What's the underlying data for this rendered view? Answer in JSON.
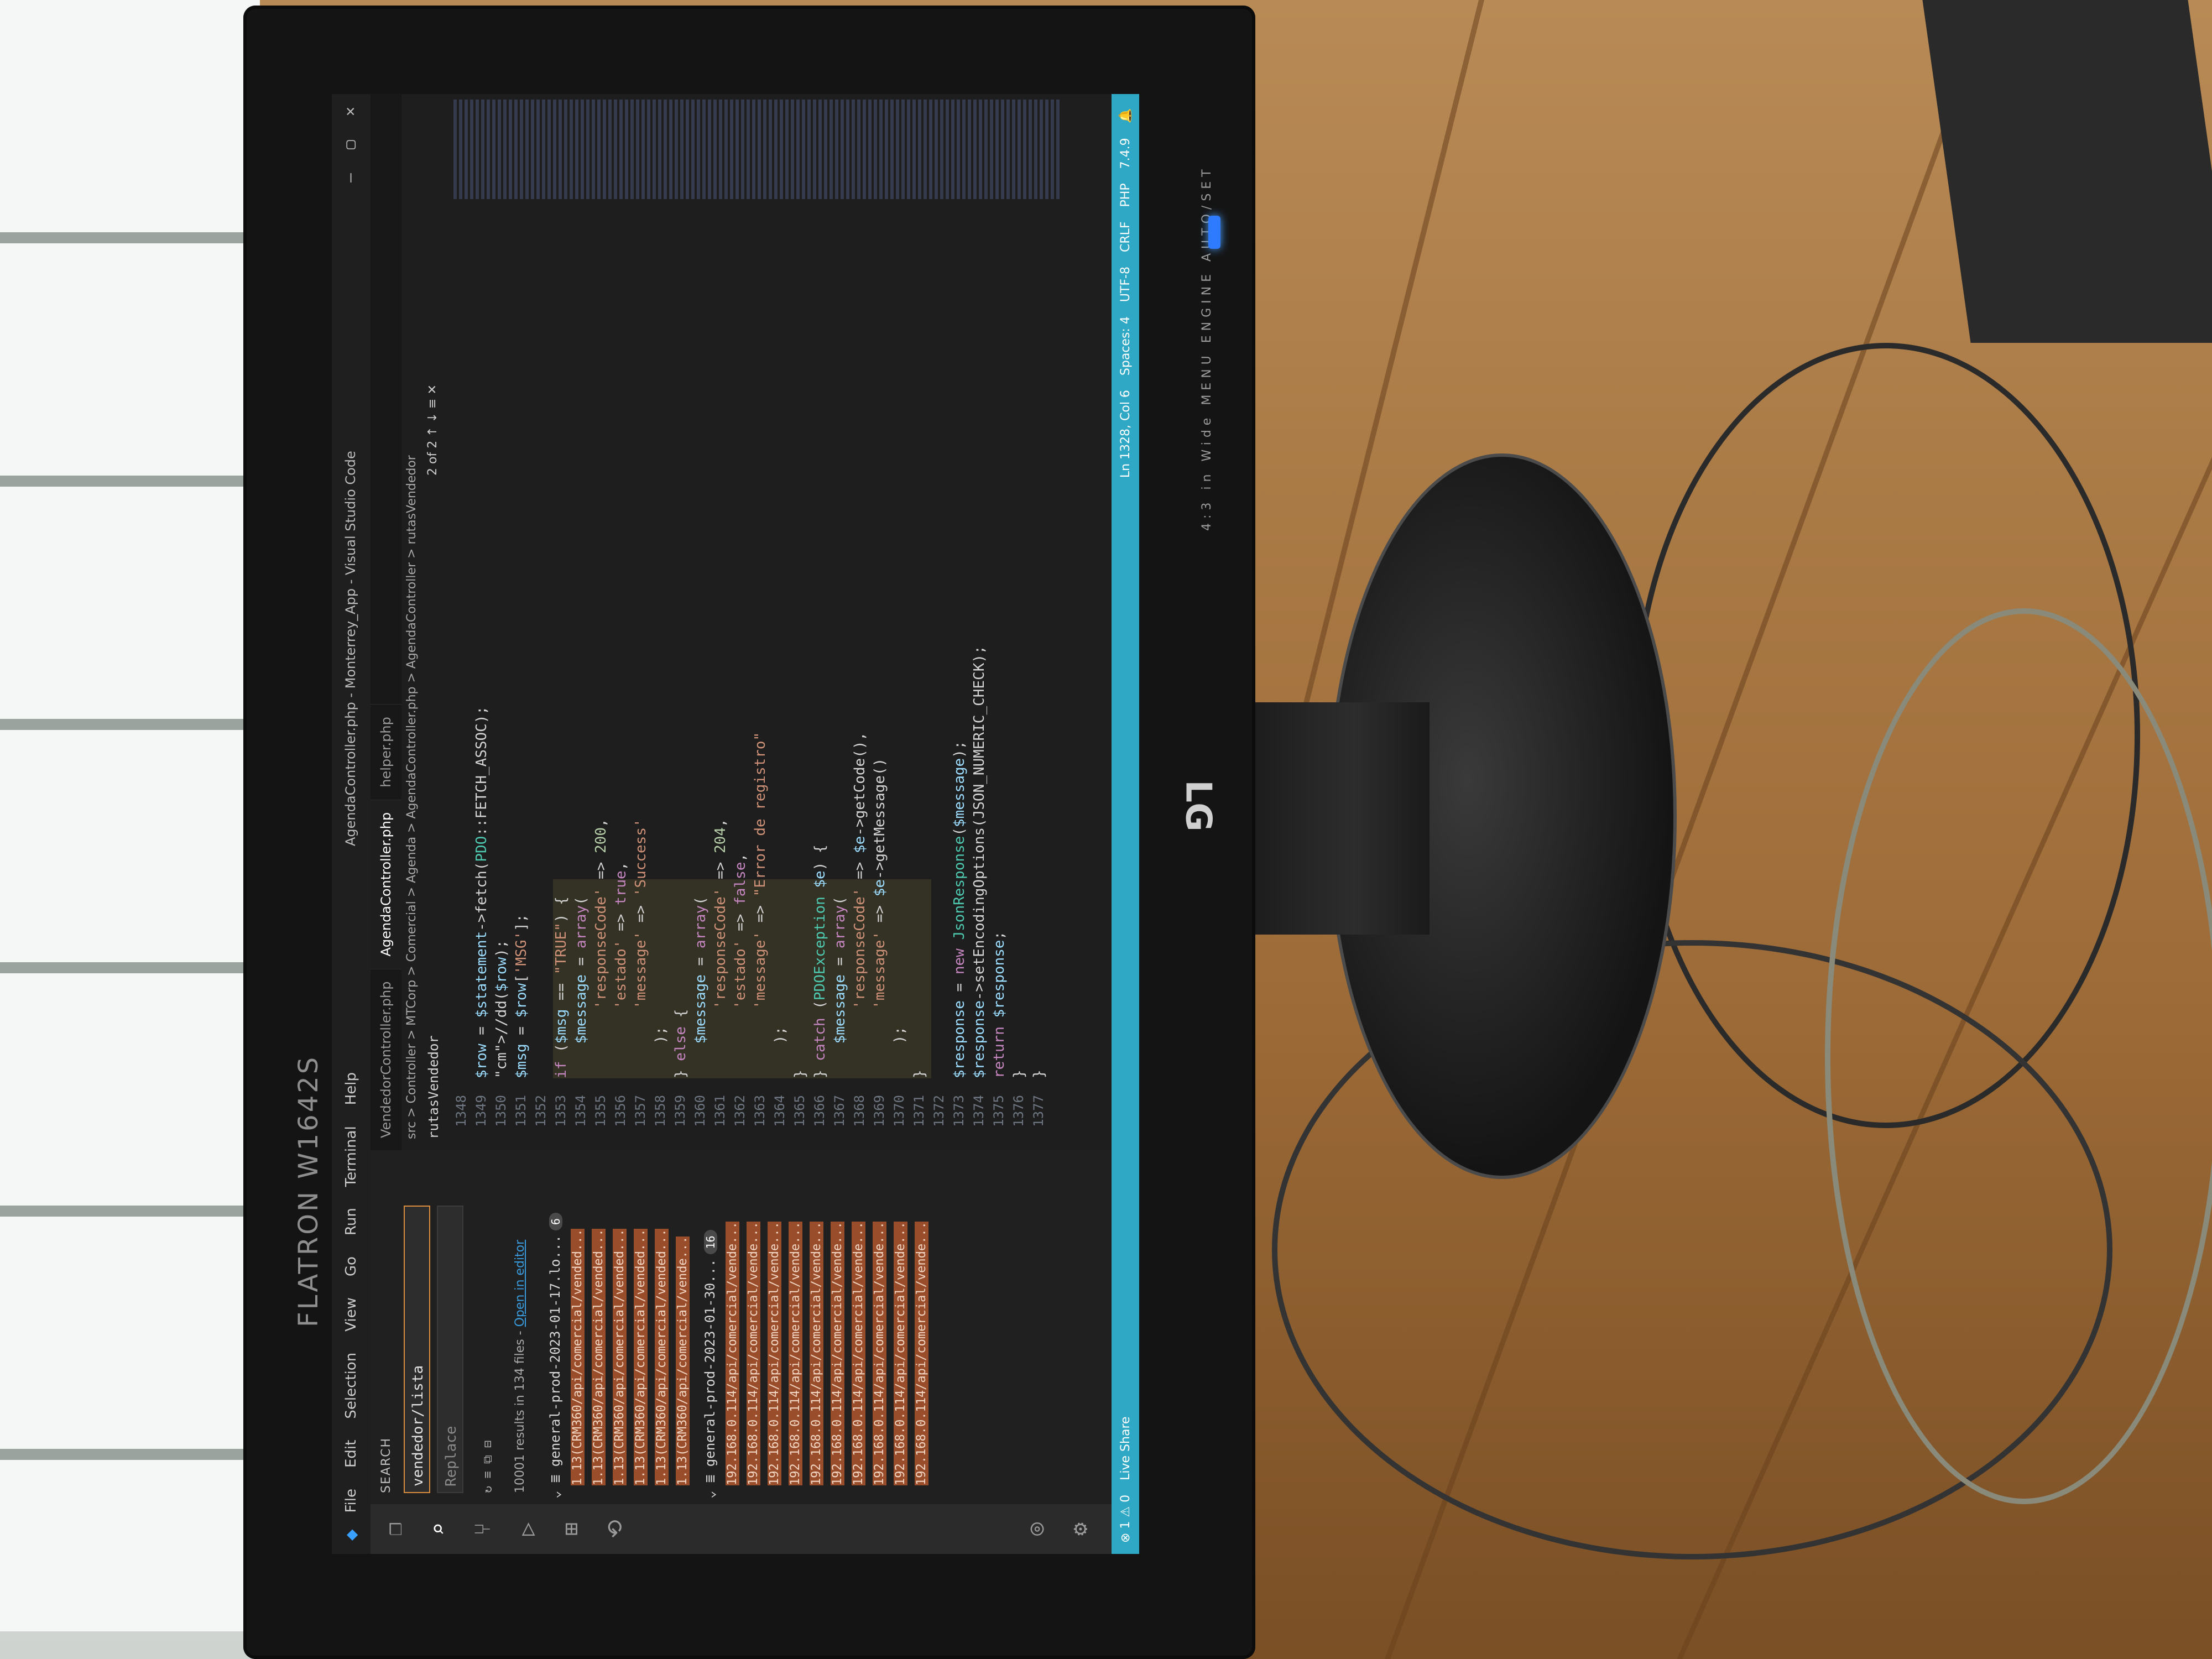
{
  "monitor": {
    "brand": "FLATRON W1642S",
    "logo": "LG",
    "controls": "4:3 in Wide   MENU   ENGINE   AUTO/SET"
  },
  "vscode": {
    "menu": [
      "File",
      "Edit",
      "Selection",
      "View",
      "Go",
      "Run",
      "Terminal",
      "Help"
    ],
    "window_title": "AgendaController.php - Monterrey_App - Visual Studio Code",
    "tabs": [
      "VendedorController.php",
      "AgendaController.php",
      "helper.php"
    ],
    "active_tab": "AgendaController.php",
    "breadcrumbs": "src > Controller > MTCorp > Comercial > Agenda > AgendaController.php > AgendaController > rutasVendedor",
    "sticky_scroll": "rutasVendedor",
    "find_widget": "2 of 2",
    "search": {
      "title": "SEARCH",
      "query": "vendedor/lista",
      "replace_placeholder": "Replace",
      "results_summary": "10001 results in 134 files - ",
      "open_in_editor": "Open in editor",
      "groups": [
        {
          "name": "general-prod-2023-01-17.lo...",
          "count": "6"
        },
        {
          "name": "general-prod-2023-01-30...",
          "count": "16"
        }
      ],
      "results_a": [
        "1.13(CRM360/api/comercial/vended...",
        "1.13(CRM360/api/comercial/vended...",
        "1.13(CRM360/api/comercial/vended...",
        "1.13(CRM360/api/comercial/vended...",
        "1.13(CRM360/api/comercial/vended...",
        "1.13(CRM360/api/comercial/vende..."
      ],
      "results_b": [
        "192.168.0.114/api/comercial/vende...",
        "192.168.0.114/api/comercial/vende...",
        "192.168.0.114/api/comercial/vende...",
        "192.168.0.114/api/comercial/vende...",
        "192.168.0.114/api/comercial/vende...",
        "192.168.0.114/api/comercial/vende...",
        "192.168.0.114/api/comercial/vende...",
        "192.168.0.114/api/comercial/vende...",
        "192.168.0.114/api/comercial/vende...",
        "192.168.0.114/api/comercial/vende..."
      ]
    },
    "line_numbers": [
      "1348",
      "1349",
      "1350",
      "1351",
      "1352",
      "1353",
      "1354",
      "1355",
      "1356",
      "1357",
      "1358",
      "1359",
      "1360",
      "1361",
      "1362",
      "1363",
      "1364",
      "1365",
      "1366",
      "1367",
      "1368",
      "1369",
      "1370",
      "1371",
      "1372",
      "1373",
      "1374",
      "1375",
      "1376",
      "1377"
    ],
    "code": [
      "",
      "$row = $statement->fetch(PDO::FETCH_ASSOC);",
      "//dd($row);",
      "$msg = $row['MSG'];",
      "",
      "if ($msg == \"TRUE\") {",
      "    $message = array(",
      "        'responseCode' => 200,",
      "        'estado' => true,",
      "        'message' => 'Success'",
      "    );",
      "} else {",
      "    $message = array(",
      "        'responseCode' => 204,",
      "        'estado' => false,",
      "        'message' => \"Error de registro\"",
      "    );",
      "}",
      "} catch (PDOException $e) {",
      "    $message = array(",
      "        'responseCode' => $e->getCode(),",
      "        'message' => $e->getMessage()",
      "    );",
      "}",
      "",
      "$response = new JsonResponse($message);",
      "$response->setEncodingOptions(JSON_NUMERIC_CHECK);",
      "return $response;",
      "}",
      "}"
    ],
    "status": {
      "left": "⊗ 1 ⚠ 0",
      "live_share": "Live Share",
      "position": "Ln 1328, Col 6",
      "spaces": "Spaces: 4",
      "encoding": "UTF-8",
      "eol": "CRLF",
      "language": "PHP",
      "version": "7.4.9"
    }
  },
  "colors": {
    "status_bar": "#2ea8c5",
    "search_highlight": "#9a4d2a",
    "power_led": "#2f7bff"
  }
}
